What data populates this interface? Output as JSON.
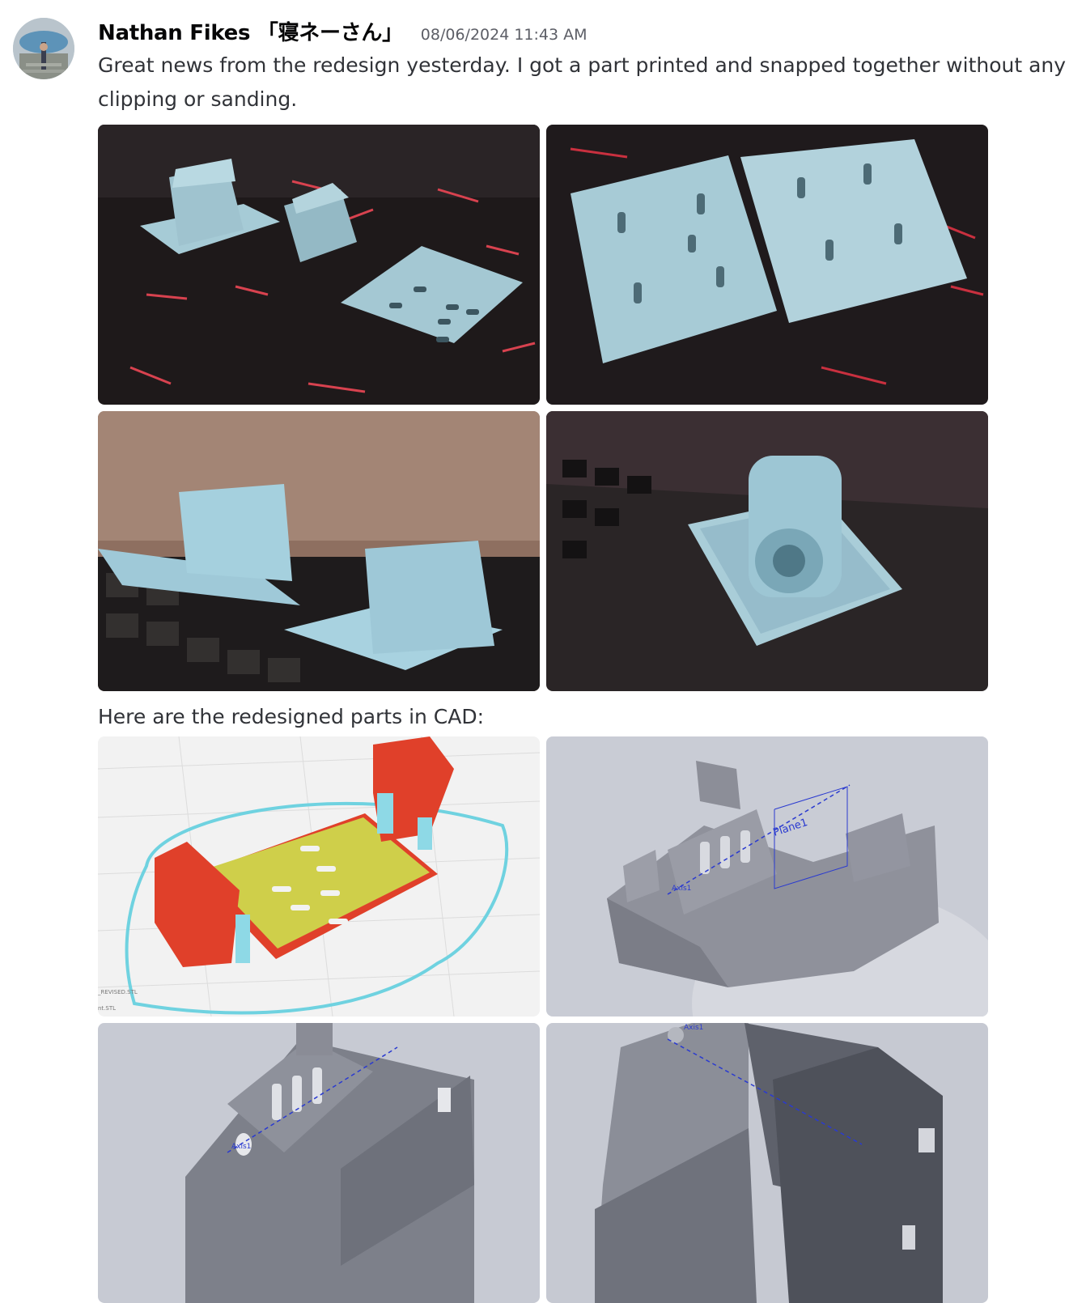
{
  "message": {
    "author": "Nathan Fikes 「寝ネーさん」",
    "timestamp": "08/06/2024 11:43 AM",
    "text": "Great news from the redesign yesterday. I got a part printed and snapped together without any clipping or sanding.",
    "second_text": "Here are the redesigned parts in CAD:"
  },
  "photo_attachments": [
    {
      "name": "printed-parts-photo-1"
    },
    {
      "name": "printed-parts-photo-2"
    },
    {
      "name": "printed-parts-photo-3"
    },
    {
      "name": "printed-parts-photo-4"
    }
  ],
  "cad_attachments": [
    {
      "name": "slicer-preview",
      "file_labels": [
        "_REVISED.STL",
        "nt.STL"
      ]
    },
    {
      "name": "cad-render-1",
      "labels": [
        "Plane1",
        "Axis1"
      ]
    },
    {
      "name": "cad-render-2",
      "labels": [
        "Axis1"
      ]
    },
    {
      "name": "cad-render-3",
      "labels": [
        "Axis1"
      ]
    }
  ],
  "colors": {
    "print_blue": "#9fc3cf",
    "mat_dark": "#1c1718",
    "mat_red": "#d63b4b",
    "slicer_red": "#e0402a",
    "slicer_yellow": "#cfcf4a",
    "slicer_cyan": "#7fd6e4",
    "cad_bg": "#c7cad3",
    "cad_gray": "#8a8c96"
  }
}
